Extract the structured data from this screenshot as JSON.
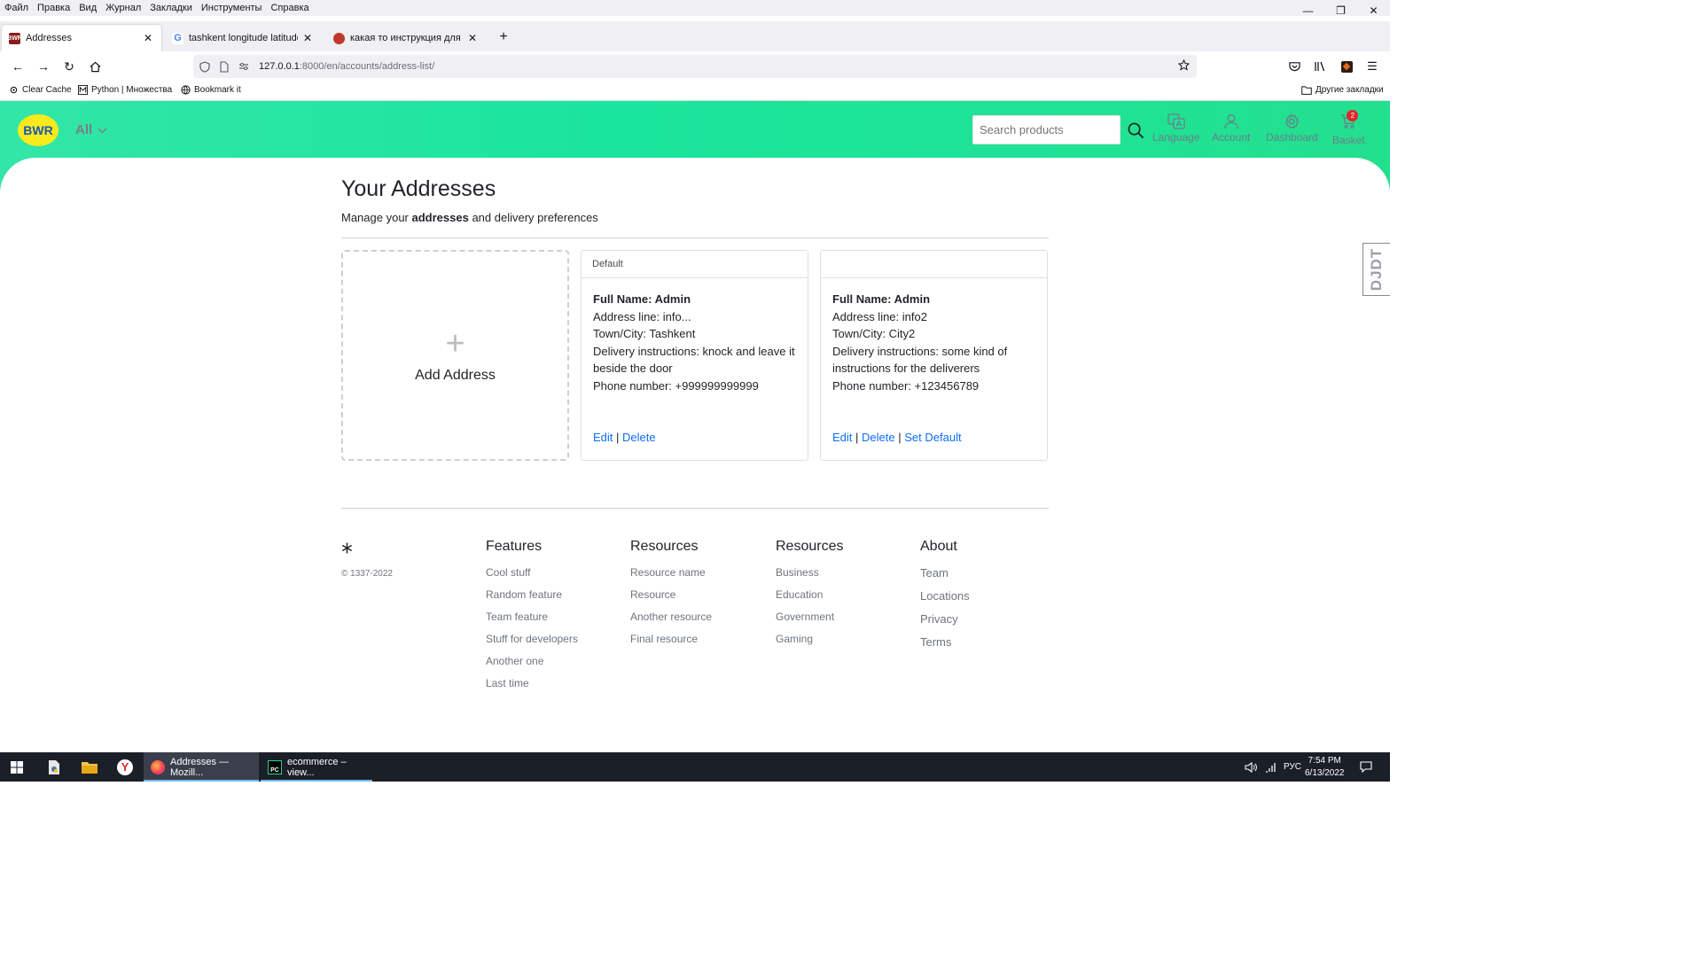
{
  "menu": [
    "Файл",
    "Правка",
    "Вид",
    "Журнал",
    "Закладки",
    "Инструменты",
    "Справка"
  ],
  "tabs": [
    {
      "title": "Addresses",
      "favicon": "BWR"
    },
    {
      "title": "tashkent longitude latitude - По"
    },
    {
      "title": "какая то инструкция для доста"
    }
  ],
  "url": {
    "host": "127.0.0.1",
    "rest": ":8000/en/accounts/address-list/"
  },
  "bookmarks": [
    "Clear Cache",
    "Python | Множества",
    "Bookmark it"
  ],
  "bookmarks_other": "Другие закладки",
  "site": {
    "logo": "BWR",
    "category": "All",
    "search_placeholder": "Search products",
    "nav": {
      "language": "Language",
      "account": "Account",
      "dashboard": "Dashboard",
      "basket": "Basket",
      "basket_count": "2"
    }
  },
  "page": {
    "title": "Your Addresses",
    "subtitle_pre": "Manage your ",
    "subtitle_bold": "addresses",
    "subtitle_post": " and delivery preferences",
    "add_label": "Add Address",
    "plus": "+"
  },
  "addresses": [
    {
      "header": "Default",
      "full_name": "Full Name: Admin",
      "address_line": "Address line: info...",
      "town": "Town/City: Tashkent",
      "instructions": "Delivery instructions: knock and leave it beside the door",
      "phone": "Phone number: +999999999999",
      "edit": "Edit",
      "delete": "Delete",
      "sep": "|"
    },
    {
      "header": "",
      "full_name": "Full Name: Admin",
      "address_line": "Address line: info2",
      "town": "Town/City: City2",
      "instructions": "Delivery instructions: some kind of instructions for the deliverers",
      "phone": "Phone number: +123456789",
      "edit": "Edit",
      "delete": "Delete",
      "set_default": "Set Default",
      "sep": "|"
    }
  ],
  "footer": {
    "brand": "*",
    "copyright": "© 1337-2022",
    "columns": [
      {
        "title": "Features",
        "links": [
          "Cool stuff",
          "Random feature",
          "Team feature",
          "Stuff for developers",
          "Another one",
          "Last time"
        ]
      },
      {
        "title": "Resources",
        "links": [
          "Resource name",
          "Resource",
          "Another resource",
          "Final resource"
        ]
      },
      {
        "title": "Resources",
        "links": [
          "Business",
          "Education",
          "Government",
          "Gaming"
        ]
      },
      {
        "title": "About",
        "links": [
          "Team",
          "Locations",
          "Privacy",
          "Terms"
        ]
      }
    ]
  },
  "djdt": "DJDT",
  "taskbar": {
    "apps": [
      {
        "label": "Addresses — Mozill..."
      },
      {
        "label": "ecommerce – view..."
      }
    ],
    "lang": "РУС",
    "time": "7:54 PM",
    "date": "6/13/2022"
  },
  "colors": {
    "accent": "#1de39a",
    "link": "#0d6efd",
    "logo_bg": "#f9ea1c",
    "logo_text": "#1a56b8"
  }
}
